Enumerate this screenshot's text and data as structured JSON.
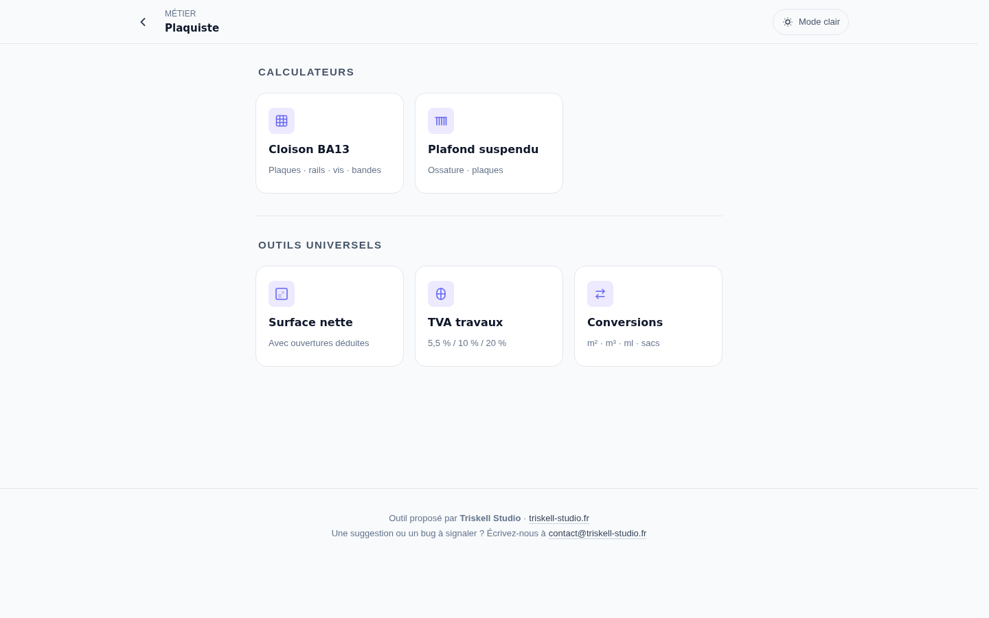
{
  "header": {
    "eyebrow": "MÉTIER",
    "title": "Plaquiste",
    "theme_button": {
      "label": "Mode clair"
    }
  },
  "sections": [
    {
      "title": "CALCULATEURS",
      "cards": [
        {
          "title": "Cloison BA13",
          "subtitle": "Plaques · rails · vis · bandes"
        },
        {
          "title": "Plafond suspendu",
          "subtitle": "Ossature · plaques"
        }
      ]
    },
    {
      "title": "OUTILS UNIVERSELS",
      "cards": [
        {
          "title": "Surface nette",
          "subtitle": "Avec ouvertures déduites"
        },
        {
          "title": "TVA travaux",
          "subtitle": "5,5 % / 10 % / 20 %"
        },
        {
          "title": "Conversions",
          "subtitle": "m² · m³ · ml · sacs"
        }
      ]
    }
  ],
  "footer": {
    "lines": [
      {
        "text": "Outil proposé par **Triskell Studio** ·",
        "link": "triskell-studio.fr"
      },
      {
        "text": "Une suggestion ou un bug à signaler ? Écrivez-nous à",
        "link": "contact@triskell-studio.fr"
      }
    ]
  }
}
